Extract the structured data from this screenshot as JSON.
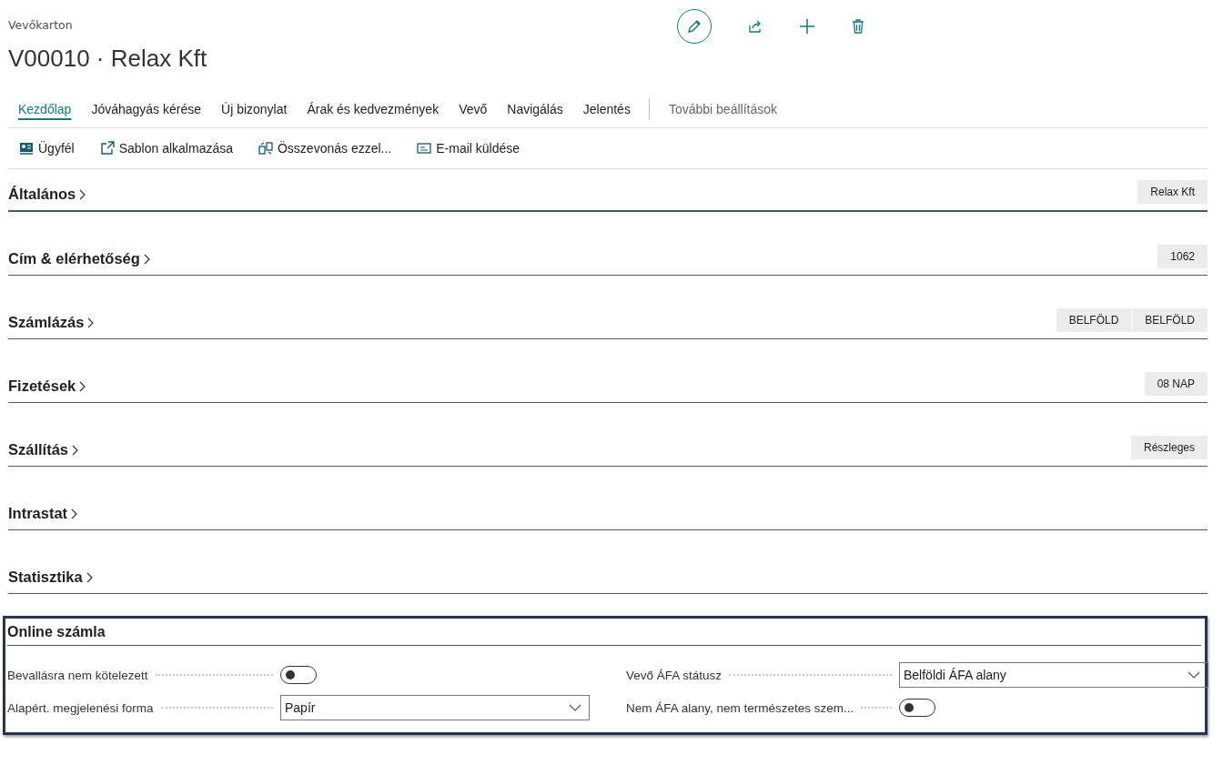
{
  "header": {
    "caption": "Vevőkarton",
    "title": "V00010 · Relax Kft"
  },
  "tabs": [
    {
      "label": "Kezdőlap",
      "selected": true
    },
    {
      "label": "Jóváhagyás kérése",
      "selected": false
    },
    {
      "label": "Új bizonylat",
      "selected": false
    },
    {
      "label": "Árak és kedvezmények",
      "selected": false
    },
    {
      "label": "Vevő",
      "selected": false
    },
    {
      "label": "Navigálás",
      "selected": false
    },
    {
      "label": "Jelentés",
      "selected": false
    }
  ],
  "more_tab": "További beállítások",
  "actions": [
    {
      "label": "Ügyfél",
      "kind": "card"
    },
    {
      "label": "Sablon alkalmazása",
      "kind": "template"
    },
    {
      "label": "Összevonás ezzel...",
      "kind": "merge"
    },
    {
      "label": "E-mail küldése",
      "kind": "mail"
    }
  ],
  "sections": [
    {
      "title": "Általános",
      "selected": true,
      "summary": [
        "Relax Kft"
      ]
    },
    {
      "title": "Cím & elérhetőség",
      "selected": false,
      "summary": [
        "1062"
      ]
    },
    {
      "title": "Számlázás",
      "selected": false,
      "summary": [
        "BELFÖLD",
        "BELFÖLD"
      ]
    },
    {
      "title": "Fizetések",
      "selected": false,
      "summary": [
        "08 NAP"
      ]
    },
    {
      "title": "Szállítás",
      "selected": false,
      "summary": [
        "Részleges"
      ]
    },
    {
      "title": "Intrastat",
      "selected": false
    },
    {
      "title": "Statisztika",
      "selected": false
    }
  ],
  "online": {
    "title": "Online számla",
    "fields": [
      {
        "label": "Bevallásra nem kötelezett",
        "kind": "toggle",
        "on": false
      },
      {
        "label": "Vevő ÁFA státusz",
        "kind": "select",
        "value": "Belföldi ÁFA alany"
      },
      {
        "label": "Alapért. megjelenési forma",
        "kind": "select",
        "value": "Papír"
      },
      {
        "label": "Nem ÁFA alany, nem természetes szem...",
        "kind": "toggle",
        "on": false
      }
    ]
  }
}
